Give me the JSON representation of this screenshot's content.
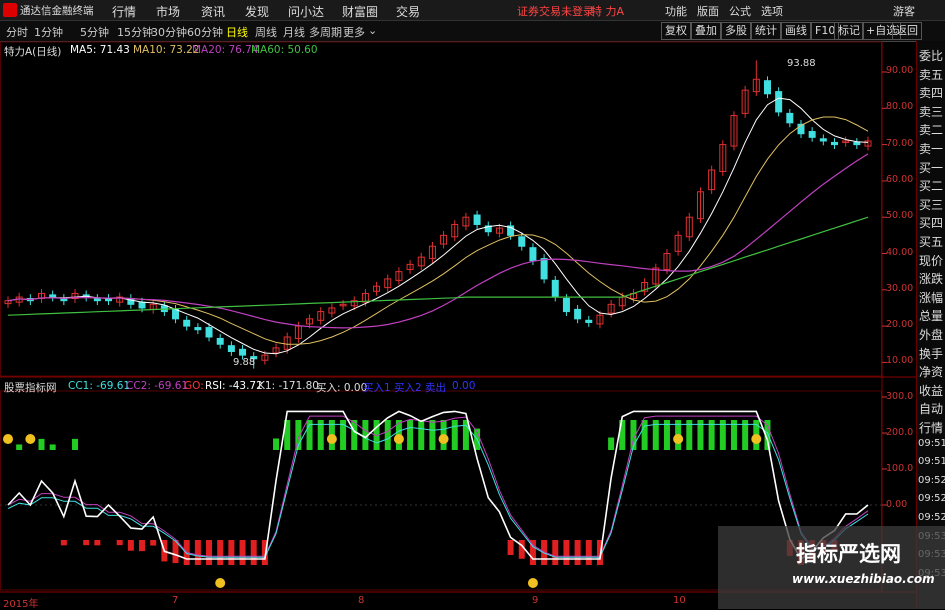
{
  "titlebar": {
    "app_name": "通达信金融终端",
    "menus": [
      "行情",
      "市场",
      "资讯",
      "发现",
      "问小达",
      "财富圈",
      "交易"
    ],
    "login_status": "证券交易未登录",
    "stock_name": "特 力A",
    "right_items": [
      "功能",
      "版面",
      "公式",
      "选项"
    ],
    "guest": "游客"
  },
  "toolbar": {
    "periods": [
      "分时",
      "1分钟",
      "5分钟",
      "15分钟",
      "30分钟",
      "60分钟",
      "日线",
      "周线",
      "月线",
      "多周期",
      "更多"
    ],
    "selected_period": "日线",
    "right_buttons": [
      "复权",
      "叠加",
      "多股",
      "统计",
      "画线",
      "F10",
      "标记",
      "+自选",
      "返回"
    ]
  },
  "main_legend": {
    "title": "特力A(日线)",
    "ma5": "MA5: 71.43",
    "ma10": "MA10: 73.22",
    "ma20": "MA20: 76.74",
    "ma60": "MA60: 50.60"
  },
  "annotations": {
    "high": "93.88",
    "low": "9.88"
  },
  "sub_legend": {
    "title": "股票指标网",
    "cc1": "CC1: -69.61",
    "cc2": "CC2: -69.61",
    "go": "GO:",
    "rsi": "RSI: -43.72",
    "k1": "K1: -171.80",
    "buy": "买入: 0.00",
    "extra1": "买入1",
    "extra2": "买入2",
    "extra3": "卖出",
    "extra4": "0.00"
  },
  "right_panel": {
    "items": [
      "委比",
      "卖五",
      "卖四",
      "卖三",
      "卖二",
      "卖一",
      "买一",
      "买二",
      "买三",
      "买四",
      "买五",
      "现价",
      "涨跌",
      "涨幅",
      "总量",
      "外盘",
      "换手",
      "净资",
      "收益",
      "自动",
      "行情",
      "09:51",
      "09:51",
      "09:52",
      "09:52",
      "09:52",
      "09:53",
      "09:53",
      "09:53"
    ]
  },
  "price_axis": [
    "90.00",
    "80.00",
    "70.00",
    "60.00",
    "50.00",
    "40.00",
    "30.00",
    "20.00",
    "10.00"
  ],
  "indicator_axis": [
    "300.0",
    "200.0",
    "100.0",
    "0.00"
  ],
  "x_axis": [
    "2015年",
    "7",
    "8",
    "9",
    "10"
  ],
  "watermark": {
    "title": "指标严选网",
    "url": "www.xuezhibiao.com"
  },
  "colors": {
    "up": "#e03030",
    "down": "#40e0e0",
    "ma5": "#ffffff",
    "ma10": "#e0c060",
    "ma20": "#c040c0",
    "ma60": "#40c040"
  },
  "chart_data": {
    "type": "candlestick",
    "price_ylim": [
      10,
      95
    ],
    "closes": [
      27,
      28,
      27,
      29,
      28,
      27,
      29,
      28,
      27,
      27,
      28,
      26,
      25,
      26,
      24,
      22,
      20,
      19,
      17,
      15,
      13,
      12,
      11,
      12,
      14,
      17,
      20,
      22,
      24,
      25,
      26,
      27,
      29,
      31,
      33,
      35,
      37,
      39,
      42,
      45,
      48,
      50,
      48,
      46,
      47,
      45,
      42,
      38,
      33,
      28,
      24,
      22,
      21,
      23,
      26,
      28,
      29,
      32,
      36,
      40,
      45,
      50,
      57,
      63,
      70,
      78,
      85,
      88,
      84,
      79,
      76,
      73,
      72,
      71,
      70,
      71,
      70,
      71
    ]
  }
}
